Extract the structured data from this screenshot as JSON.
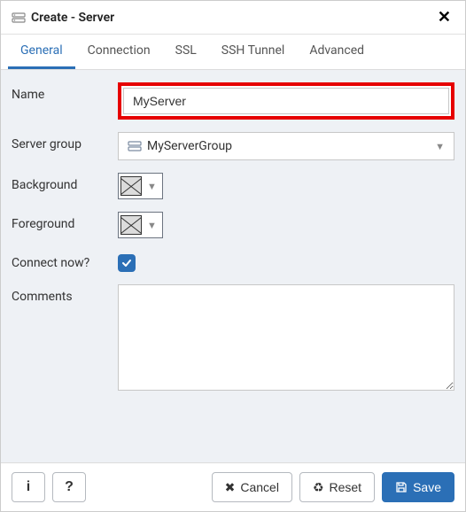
{
  "dialog": {
    "title": "Create - Server"
  },
  "tabs": {
    "items": [
      {
        "label": "General",
        "active": true
      },
      {
        "label": "Connection",
        "active": false
      },
      {
        "label": "SSL",
        "active": false
      },
      {
        "label": "SSH Tunnel",
        "active": false
      },
      {
        "label": "Advanced",
        "active": false
      }
    ]
  },
  "form": {
    "name": {
      "label": "Name",
      "value": "MyServer"
    },
    "server_group": {
      "label": "Server group",
      "value": "MyServerGroup"
    },
    "background": {
      "label": "Background"
    },
    "foreground": {
      "label": "Foreground"
    },
    "connect_now": {
      "label": "Connect now?",
      "checked": true
    },
    "comments": {
      "label": "Comments",
      "value": ""
    }
  },
  "footer": {
    "info": "i",
    "help": "?",
    "cancel": "Cancel",
    "reset": "Reset",
    "save": "Save"
  }
}
